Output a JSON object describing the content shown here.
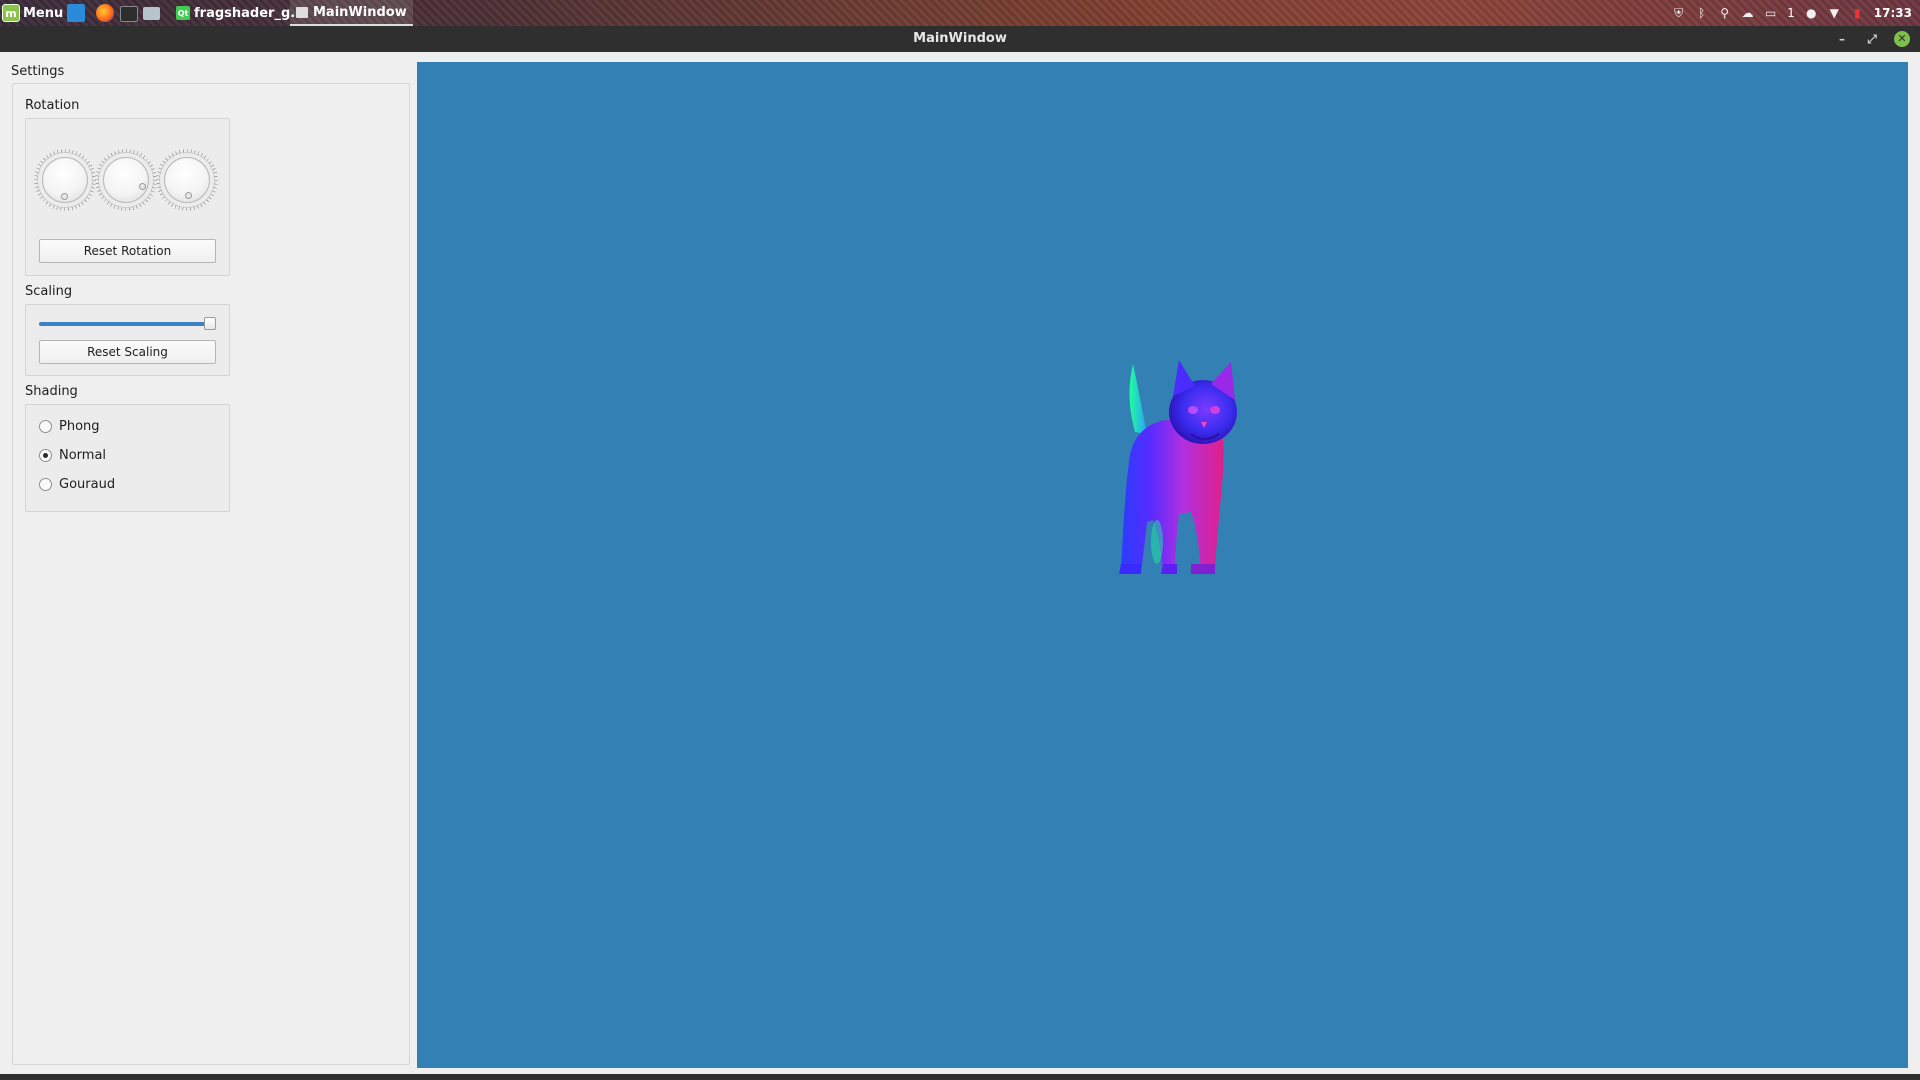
{
  "taskbar": {
    "menu_label": "Menu",
    "menu_icon": "mint-menu-icon",
    "launchers": [
      "show-desktop-icon",
      "firefox-icon",
      "terminal-icon",
      "files-icon"
    ],
    "tasks": [
      {
        "label": "fragshader_g...",
        "icon": "qt-icon",
        "active": false
      },
      {
        "label": "MainWindow",
        "icon": "window-icon",
        "active": true
      }
    ],
    "tray_icons": [
      "shield-icon",
      "bluetooth-icon",
      "location-icon",
      "network-icon",
      "notifications-icon",
      "user-icon",
      "wifi-icon",
      "battery-icon"
    ],
    "notification_count": "1",
    "clock": "17:33"
  },
  "window": {
    "title": "MainWindow",
    "controls": {
      "minimize": "–",
      "maximize": "⤢",
      "close": "✕"
    }
  },
  "settings": {
    "title": "Settings",
    "rotation": {
      "title": "Rotation",
      "dials": [
        {
          "name": "rotation-dial-x"
        },
        {
          "name": "rotation-dial-y"
        },
        {
          "name": "rotation-dial-z"
        }
      ],
      "reset_label": "Reset Rotation"
    },
    "scaling": {
      "title": "Scaling",
      "slider_value_fraction": 1.0,
      "reset_label": "Reset Scaling"
    },
    "shading": {
      "title": "Shading",
      "options": [
        "Phong",
        "Normal",
        "Gouraud"
      ],
      "selected": "Normal"
    }
  },
  "viewport": {
    "background_color": "#3380b4",
    "content": "cat-model (normal shaded)"
  },
  "colors": {
    "window_bg": "#efefef",
    "titlebar_bg": "#2f2f2f",
    "accent": "#3b84c4",
    "viewport_bg": "#3380b4"
  }
}
